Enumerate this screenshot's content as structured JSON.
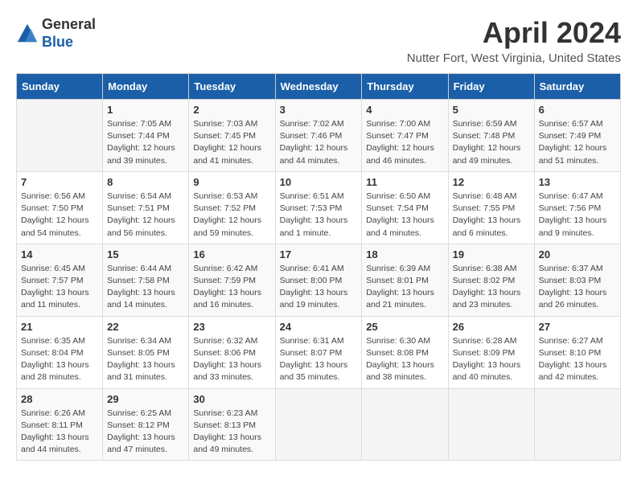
{
  "header": {
    "logo_line1": "General",
    "logo_line2": "Blue",
    "title": "April 2024",
    "subtitle": "Nutter Fort, West Virginia, United States"
  },
  "columns": [
    "Sunday",
    "Monday",
    "Tuesday",
    "Wednesday",
    "Thursday",
    "Friday",
    "Saturday"
  ],
  "weeks": [
    [
      {
        "day": "",
        "info": ""
      },
      {
        "day": "1",
        "info": "Sunrise: 7:05 AM\nSunset: 7:44 PM\nDaylight: 12 hours\nand 39 minutes."
      },
      {
        "day": "2",
        "info": "Sunrise: 7:03 AM\nSunset: 7:45 PM\nDaylight: 12 hours\nand 41 minutes."
      },
      {
        "day": "3",
        "info": "Sunrise: 7:02 AM\nSunset: 7:46 PM\nDaylight: 12 hours\nand 44 minutes."
      },
      {
        "day": "4",
        "info": "Sunrise: 7:00 AM\nSunset: 7:47 PM\nDaylight: 12 hours\nand 46 minutes."
      },
      {
        "day": "5",
        "info": "Sunrise: 6:59 AM\nSunset: 7:48 PM\nDaylight: 12 hours\nand 49 minutes."
      },
      {
        "day": "6",
        "info": "Sunrise: 6:57 AM\nSunset: 7:49 PM\nDaylight: 12 hours\nand 51 minutes."
      }
    ],
    [
      {
        "day": "7",
        "info": "Sunrise: 6:56 AM\nSunset: 7:50 PM\nDaylight: 12 hours\nand 54 minutes."
      },
      {
        "day": "8",
        "info": "Sunrise: 6:54 AM\nSunset: 7:51 PM\nDaylight: 12 hours\nand 56 minutes."
      },
      {
        "day": "9",
        "info": "Sunrise: 6:53 AM\nSunset: 7:52 PM\nDaylight: 12 hours\nand 59 minutes."
      },
      {
        "day": "10",
        "info": "Sunrise: 6:51 AM\nSunset: 7:53 PM\nDaylight: 13 hours\nand 1 minute."
      },
      {
        "day": "11",
        "info": "Sunrise: 6:50 AM\nSunset: 7:54 PM\nDaylight: 13 hours\nand 4 minutes."
      },
      {
        "day": "12",
        "info": "Sunrise: 6:48 AM\nSunset: 7:55 PM\nDaylight: 13 hours\nand 6 minutes."
      },
      {
        "day": "13",
        "info": "Sunrise: 6:47 AM\nSunset: 7:56 PM\nDaylight: 13 hours\nand 9 minutes."
      }
    ],
    [
      {
        "day": "14",
        "info": "Sunrise: 6:45 AM\nSunset: 7:57 PM\nDaylight: 13 hours\nand 11 minutes."
      },
      {
        "day": "15",
        "info": "Sunrise: 6:44 AM\nSunset: 7:58 PM\nDaylight: 13 hours\nand 14 minutes."
      },
      {
        "day": "16",
        "info": "Sunrise: 6:42 AM\nSunset: 7:59 PM\nDaylight: 13 hours\nand 16 minutes."
      },
      {
        "day": "17",
        "info": "Sunrise: 6:41 AM\nSunset: 8:00 PM\nDaylight: 13 hours\nand 19 minutes."
      },
      {
        "day": "18",
        "info": "Sunrise: 6:39 AM\nSunset: 8:01 PM\nDaylight: 13 hours\nand 21 minutes."
      },
      {
        "day": "19",
        "info": "Sunrise: 6:38 AM\nSunset: 8:02 PM\nDaylight: 13 hours\nand 23 minutes."
      },
      {
        "day": "20",
        "info": "Sunrise: 6:37 AM\nSunset: 8:03 PM\nDaylight: 13 hours\nand 26 minutes."
      }
    ],
    [
      {
        "day": "21",
        "info": "Sunrise: 6:35 AM\nSunset: 8:04 PM\nDaylight: 13 hours\nand 28 minutes."
      },
      {
        "day": "22",
        "info": "Sunrise: 6:34 AM\nSunset: 8:05 PM\nDaylight: 13 hours\nand 31 minutes."
      },
      {
        "day": "23",
        "info": "Sunrise: 6:32 AM\nSunset: 8:06 PM\nDaylight: 13 hours\nand 33 minutes."
      },
      {
        "day": "24",
        "info": "Sunrise: 6:31 AM\nSunset: 8:07 PM\nDaylight: 13 hours\nand 35 minutes."
      },
      {
        "day": "25",
        "info": "Sunrise: 6:30 AM\nSunset: 8:08 PM\nDaylight: 13 hours\nand 38 minutes."
      },
      {
        "day": "26",
        "info": "Sunrise: 6:28 AM\nSunset: 8:09 PM\nDaylight: 13 hours\nand 40 minutes."
      },
      {
        "day": "27",
        "info": "Sunrise: 6:27 AM\nSunset: 8:10 PM\nDaylight: 13 hours\nand 42 minutes."
      }
    ],
    [
      {
        "day": "28",
        "info": "Sunrise: 6:26 AM\nSunset: 8:11 PM\nDaylight: 13 hours\nand 44 minutes."
      },
      {
        "day": "29",
        "info": "Sunrise: 6:25 AM\nSunset: 8:12 PM\nDaylight: 13 hours\nand 47 minutes."
      },
      {
        "day": "30",
        "info": "Sunrise: 6:23 AM\nSunset: 8:13 PM\nDaylight: 13 hours\nand 49 minutes."
      },
      {
        "day": "",
        "info": ""
      },
      {
        "day": "",
        "info": ""
      },
      {
        "day": "",
        "info": ""
      },
      {
        "day": "",
        "info": ""
      }
    ]
  ]
}
